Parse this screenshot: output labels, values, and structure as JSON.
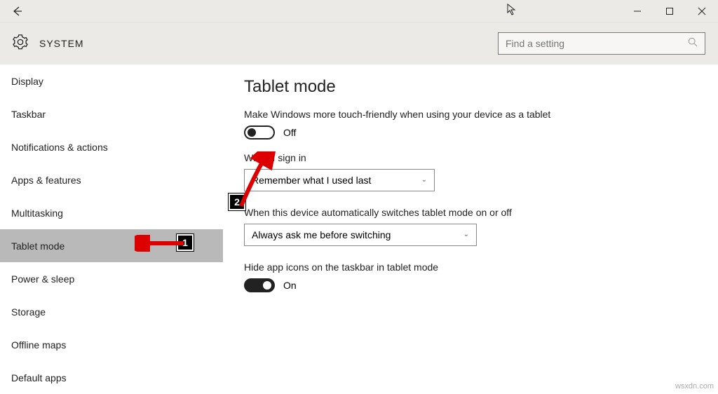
{
  "header": {
    "title": "SYSTEM",
    "search_placeholder": "Find a setting"
  },
  "sidebar": {
    "items": [
      {
        "label": "Display"
      },
      {
        "label": "Taskbar"
      },
      {
        "label": "Notifications & actions"
      },
      {
        "label": "Apps & features"
      },
      {
        "label": "Multitasking"
      },
      {
        "label": "Tablet mode"
      },
      {
        "label": "Power & sleep"
      },
      {
        "label": "Storage"
      },
      {
        "label": "Offline maps"
      },
      {
        "label": "Default apps"
      }
    ]
  },
  "main": {
    "heading": "Tablet mode",
    "desc": "Make Windows more touch-friendly when using your device as a tablet",
    "toggle1_state": "Off",
    "signin_label": "When I sign in",
    "signin_value": "Remember what I used last",
    "autoswitch_label": "When this device automatically switches tablet mode on or off",
    "autoswitch_value": "Always ask me before switching",
    "hideicons_label": "Hide app icons on the taskbar in tablet mode",
    "toggle2_state": "On"
  },
  "annotations": {
    "badge1": "1",
    "badge2": "2"
  },
  "watermark": "wsxdn.com"
}
